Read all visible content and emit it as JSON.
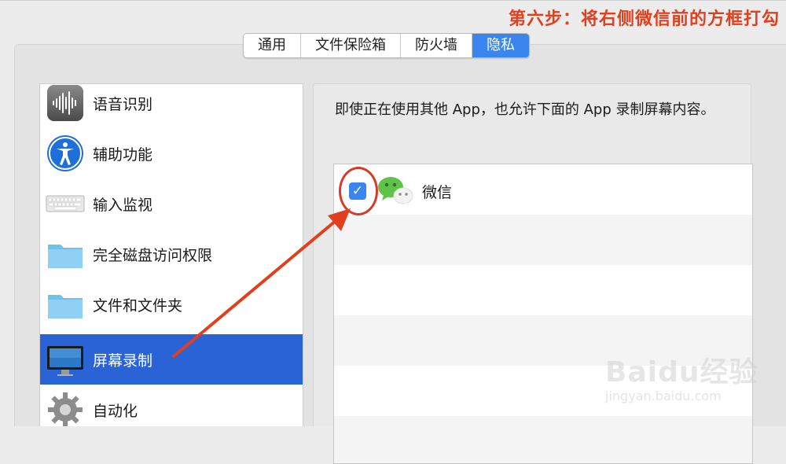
{
  "annotation": {
    "caption": "第六步：将右侧微信前的方框打勾",
    "color": "#e0401f"
  },
  "tabs": [
    {
      "label": "通用"
    },
    {
      "label": "文件保险箱"
    },
    {
      "label": "防火墙"
    },
    {
      "label": "隐私",
      "active": true
    }
  ],
  "sidebar": {
    "items": [
      {
        "label": "语音识别",
        "icon": "waveform-icon"
      },
      {
        "label": "辅助功能",
        "icon": "accessibility-icon"
      },
      {
        "label": "输入监视",
        "icon": "keyboard-icon"
      },
      {
        "label": "完全磁盘访问权限",
        "icon": "folder-icon"
      },
      {
        "label": "文件和文件夹",
        "icon": "folder-icon"
      },
      {
        "label": "屏幕录制",
        "icon": "display-icon",
        "selected": true
      },
      {
        "label": "自动化",
        "icon": "gear-icon"
      }
    ]
  },
  "content": {
    "description": "即使正在使用其他 App，也允许下面的 App 录制屏幕内容。",
    "apps": [
      {
        "name": "微信",
        "checked": true,
        "icon": "wechat-icon"
      }
    ]
  },
  "watermark": {
    "logo": "Baidu经验",
    "url": "jingyan.baidu.com"
  },
  "colors": {
    "accent": "#3b86ee",
    "selection": "#2a63d6"
  }
}
